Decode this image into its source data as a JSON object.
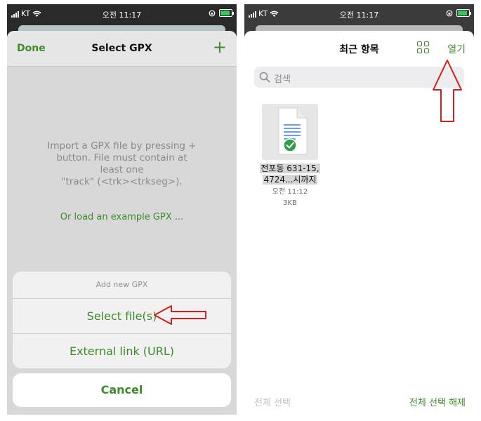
{
  "status_bar": {
    "carrier": "KT",
    "time": "오전 11:17"
  },
  "left_screen": {
    "nav": {
      "done_label": "Done",
      "title": "Select GPX",
      "add_label": "+"
    },
    "empty_message_lines": [
      "Import a GPX file by pressing +",
      "button. File must contain at",
      "least one",
      "\"track\" (<trk><trkseg>)."
    ],
    "example_link": "Or load an example GPX ...",
    "action_sheet": {
      "header": "Add new GPX",
      "items": [
        "Select file(s)",
        "External link (URL)"
      ],
      "cancel": "Cancel"
    }
  },
  "right_screen": {
    "title": "최근 항목",
    "open_label": "열기",
    "search_placeholder": "검색",
    "files": [
      {
        "name_lines": [
          "전포동 631-15,",
          "4724...시까지"
        ],
        "time": "오전 11:12",
        "size": "3KB"
      }
    ],
    "select_all": "전체 선택",
    "deselect_all": "전체 선택 해제"
  },
  "colors": {
    "accent": "#3d8b29",
    "annotation_arrow": "#d11f1f"
  }
}
